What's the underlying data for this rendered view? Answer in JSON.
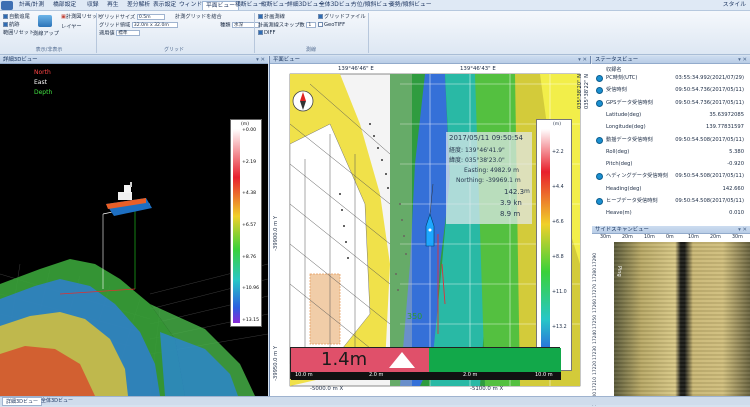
{
  "menu": {
    "items": [
      "計画/計測",
      "橋部設定",
      "収録",
      "再生",
      "差分解析",
      "表示設定",
      "ウィンドウ",
      "平面ビュー",
      "横断ビュー",
      "縦断ビュー",
      "詳細3Dビュー",
      "全体3Dビュー",
      "方位/傾斜ビュー",
      "姿勢/傾斜ビュー"
    ],
    "active": "平面ビュー",
    "style_label": "スタイル"
  },
  "ribbon": {
    "g1": {
      "auto_pan": "自動追尾",
      "track": "航跡",
      "range_reset": "範囲リセット",
      "title": "表示/非表示"
    },
    "g2": {
      "tool": "測線アップ",
      "reset": "計測図リセット",
      "layer": "レイヤー"
    },
    "g3": {
      "grid_size_label": "グリッドサイズ",
      "grid_size_value": "0.5m",
      "grid_range_label": "グリッド領域",
      "grid_range_value": "32.0m x 32.0m",
      "color_label": "適用値",
      "color_value": "標準",
      "title": "グリッド"
    },
    "g4": {
      "merge": "計測グリッドを結合",
      "kind_label": "種類",
      "kind_value": "水深"
    },
    "g5": {
      "survey_line": "計画測線",
      "skip_label": "計画測線スキップ数",
      "skip_value": "1",
      "diff": "DIFF",
      "title": "測線"
    },
    "g6": {
      "grid_file": "グリッドファイル",
      "geotiff": "GeoTIFF"
    }
  },
  "panel3d": {
    "title": "詳細3Dビュー",
    "legend": {
      "north": "North",
      "east": "East",
      "depth": "Depth"
    },
    "scale": {
      "unit": "(m)",
      "ticks": [
        "+0.00",
        "+2.19",
        "+4.38",
        "+6.57",
        "+8.76",
        "+10.96",
        "+13.15"
      ]
    }
  },
  "map": {
    "title": "平面ビュー",
    "top_coords": [
      "139°46'46\" E",
      "139°46'43\" E"
    ],
    "right_coord": "035°38'20\" N",
    "right_coord2": "035°38'22\" N",
    "left_coords": [
      "-39900.0 m Y",
      "-39950.0 m Y"
    ],
    "bottom_coords": [
      "-5000.0 m X",
      "-5100.0 m X"
    ],
    "info": {
      "datetime": "2017/05/11 09:50:54",
      "lon_label": "経度:",
      "lon": "139°46'41.9\"",
      "lat_label": "緯度:",
      "lat": "035°38'23.0\"",
      "easting_label": "Easting:",
      "easting": "4982.9 m",
      "northing_label": "Northing:",
      "northing": "-39969.1 m",
      "depth": "142.3",
      "depth_unit": "m",
      "speed": "3.9 kn",
      "draft": "8.9 m",
      "heading": "350"
    },
    "scale": {
      "unit": "(m)",
      "ticks": [
        "+2.2",
        "+4.4",
        "+6.6",
        "+8.8",
        "+11.0",
        "+13.2"
      ]
    },
    "bottom_bar": {
      "depth": "1.4m",
      "left_mark": "10.0 m",
      "mid_left": "2.0 m",
      "mid_right": "2.0 m",
      "right_mark": "10.0 m"
    }
  },
  "status": {
    "title": "ステータスビュー",
    "header": "収録名",
    "rows": [
      {
        "label": "PC時刻(UTC)",
        "value": "03:55:34.992(2021/07/29)",
        "dot": true
      },
      {
        "label": "受信時刻",
        "value": "09:50:54.736(2017/05/11)",
        "dot": true
      },
      {
        "label": "GPSデータ受信時刻",
        "value": "09:50:54.736(2017/05/11)",
        "dot": true
      },
      {
        "label": "Latitude(deg)",
        "value": "35.63972085",
        "dot": false
      },
      {
        "label": "Longitude(deg)",
        "value": "139.77831597",
        "dot": false
      },
      {
        "label": "動揺データ受信時刻",
        "value": "09:50:54.508(2017/05/11)",
        "dot": true
      },
      {
        "label": "Roll(deg)",
        "value": "5.380",
        "dot": false
      },
      {
        "label": "Pitch(deg)",
        "value": "-0.920",
        "dot": false
      },
      {
        "label": "ヘディングデータ受信時刻",
        "value": "09:50:54.508(2017/05/11)",
        "dot": true
      },
      {
        "label": "Heading(deg)",
        "value": "142.660",
        "dot": false
      },
      {
        "label": "ヒーブデータ受信時刻",
        "value": "09:50:54.508(2017/05/11)",
        "dot": true
      },
      {
        "label": "Heave(m)",
        "value": "0.010",
        "dot": false
      }
    ]
  },
  "side": {
    "title": "サイドスキャンビュー",
    "ticks": [
      "30m",
      "20m",
      "10m",
      "0m",
      "10m",
      "20m",
      "30m"
    ],
    "y_ticks": [
      "17200",
      "17210",
      "17220",
      "17230",
      "17240",
      "17250",
      "17260",
      "17270",
      "17280",
      "17290"
    ],
    "label": "Ping"
  },
  "bottom_tabs": [
    "詳細3Dビュー",
    "全体3Dビュー"
  ]
}
